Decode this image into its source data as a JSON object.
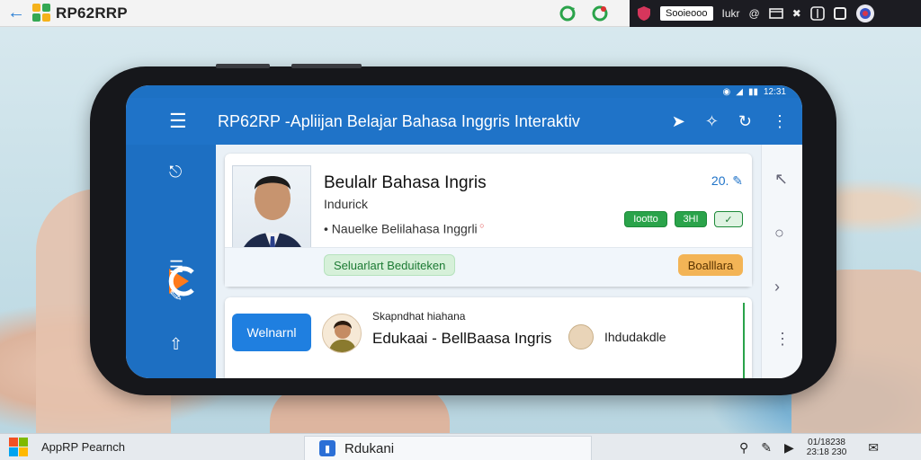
{
  "window": {
    "title": "RP62RRP"
  },
  "topbar_right": {
    "field_value": "Sooieooo",
    "label": "Iukr"
  },
  "phone": {
    "status_time": "12:31",
    "appbar_title": "RP62RP -Apliijan Belajar Bahasa Inggris Interaktiv"
  },
  "card1": {
    "title": "Beulalr Bahasa Ingris",
    "subtitle": "Indurick",
    "bullet": "Nauelke  Belilahasa Inggrli",
    "number": "20.",
    "chips": [
      "Iootto",
      "3HI"
    ],
    "green_label": "Seluarlart Beduiteken",
    "orange_label": "Boalllara"
  },
  "card2": {
    "blue_button": "Welnarnl",
    "small_text": "Skapndhat hiahana",
    "main_text": "Edukaai - BellBaasa Ingris",
    "right_text": "Ihdudakdle"
  },
  "taskbar": {
    "app_label": "AppRP Pearnch",
    "center_label": "Rdukani",
    "clock_line1": "01/18238",
    "clock_line2": "23:18 230"
  },
  "colors": {
    "primary": "#1f73c8",
    "green": "#2aa34a",
    "orange": "#f3b456"
  }
}
